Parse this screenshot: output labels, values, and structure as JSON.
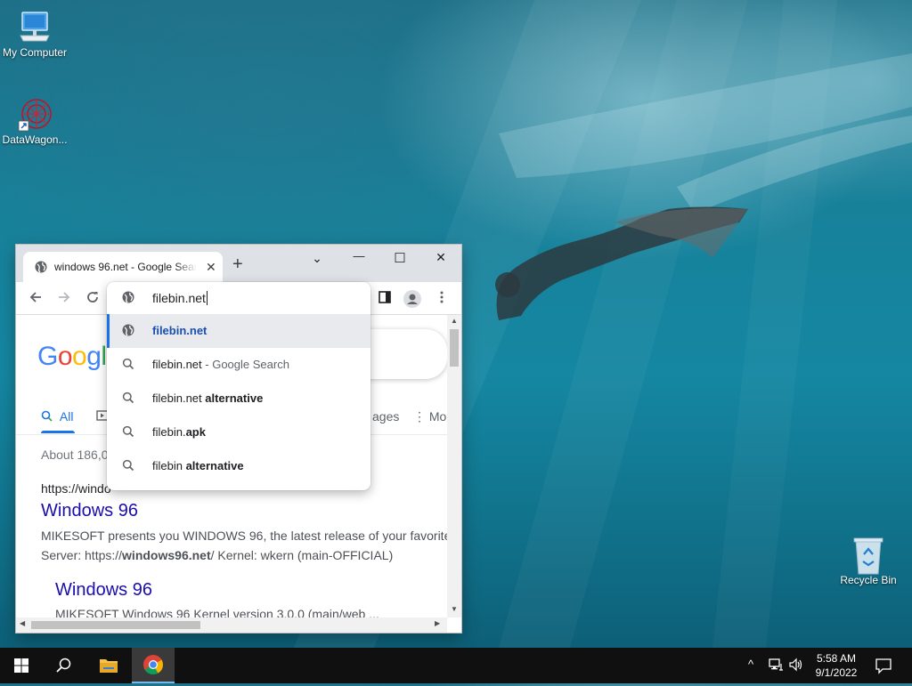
{
  "desktop": {
    "icons": [
      {
        "label": "My Computer"
      },
      {
        "label": "DataWagon..."
      },
      {
        "label": "Recycle Bin"
      }
    ]
  },
  "browser": {
    "tab": {
      "title": "windows 96.net - Google Search",
      "close": "✕"
    },
    "new_tab": "+",
    "window_controls": {
      "tab_search": "⌄",
      "minimize": "—",
      "maximize": "☐",
      "close": "✕"
    },
    "omnibox": {
      "value": "filebin.net",
      "suggestions": [
        {
          "parts": [
            {
              "text": "filebin.net",
              "bold": true,
              "link": true
            }
          ],
          "icon": "globe-icon",
          "selected": true
        },
        {
          "parts": [
            {
              "text": "filebin.net"
            },
            {
              "text": " - Google Search",
              "dim": true
            }
          ],
          "icon": "search-icon"
        },
        {
          "parts": [
            {
              "text": "filebin.net "
            },
            {
              "text": "alternative",
              "bold": true
            }
          ],
          "icon": "search-icon"
        },
        {
          "parts": [
            {
              "text": "filebin."
            },
            {
              "text": "apk",
              "bold": true
            }
          ],
          "icon": "search-icon"
        },
        {
          "parts": [
            {
              "text": "filebin "
            },
            {
              "text": "alternative",
              "bold": true
            }
          ],
          "icon": "search-icon"
        }
      ]
    },
    "page": {
      "logo": "Google",
      "tabs": {
        "all": "All",
        "images": "ages",
        "more": "Mo"
      },
      "result_stats": "About 186,0",
      "results": [
        {
          "cite": "https://windo",
          "title": "Windows 96",
          "snippet_line1": "MIKESOFT presents you WINDOWS 96, the latest release of your favorite",
          "snippet_line2_pre": "Server: https://",
          "snippet_line2_bold": "windows96.net",
          "snippet_line2_post": "/ Kernel: wkern (main-OFFICIAL)"
        },
        {
          "title": "Windows 96",
          "snippet_line1": "MIKESOFT Windows 96 Kernel version 3.0.0 (main/web ..."
        }
      ]
    }
  },
  "taskbar": {
    "time": "5:58 AM",
    "date": "9/1/2022",
    "tray": {
      "chevron": "^"
    }
  },
  "colors": {
    "google_blue": "#4285f4",
    "google_red": "#ea4335",
    "google_yellow": "#fbbc05",
    "google_green": "#34a853",
    "link": "#1a0dab",
    "accent": "#1a73e8",
    "taskbar": "#101010"
  }
}
